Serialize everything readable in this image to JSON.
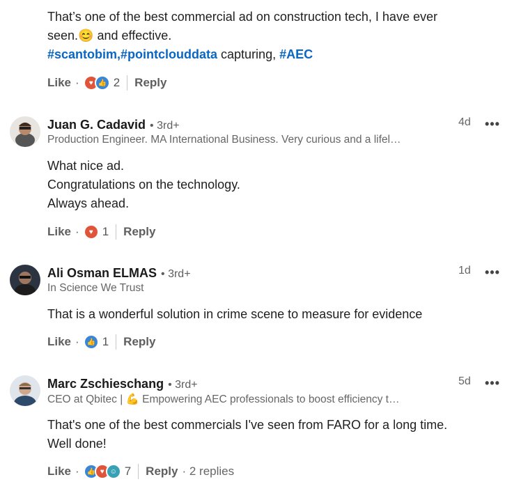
{
  "comment0": {
    "lines": [
      "That’s one of the best commercial ad on construction tech, I have ever",
      "seen."
    ],
    "line2_suffix": " and effective.",
    "emoji": "😊",
    "hashtag1": "#scantobim",
    "hashtag2": ",#pointclouddata",
    "mid_text": " capturing, ",
    "hashtag3": "#AEC",
    "like_label": "Like",
    "reaction_count": "2",
    "reply_label": "Reply"
  },
  "comment1": {
    "name": "Juan G. Cadavid",
    "degree": "• 3rd+",
    "headline": "Production Engineer. MA International Business. Very curious and a lifel…",
    "time": "4d",
    "more": "•••",
    "lines": [
      "What nice ad.",
      "Congratulations on the technology.",
      "Always ahead."
    ],
    "like_label": "Like",
    "reaction_count": "1",
    "reply_label": "Reply"
  },
  "comment2": {
    "name": "Ali Osman ELMAS",
    "degree": "• 3rd+",
    "headline": "In Science We Trust",
    "time": "1d",
    "more": "•••",
    "lines": [
      "That is a wonderful solution in crime scene to measure for evidence"
    ],
    "like_label": "Like",
    "reaction_count": "1",
    "reply_label": "Reply"
  },
  "comment3": {
    "name": "Marc Zschieschang",
    "degree": "• 3rd+",
    "headline": "CEO at Qbitec | 💪 Empowering AEC professionals to boost efficiency t…",
    "time": "5d",
    "more": "•••",
    "lines": [
      "That's one of the best commercials I've seen from FARO for a long time.",
      "Well done!"
    ],
    "like_label": "Like",
    "reaction_count": "7",
    "reply_label": "Reply",
    "replies_label": "· 2 replies"
  },
  "colors": {
    "accent": "#0a66c2",
    "love": "#e0553a",
    "like": "#3a85d6",
    "funny": "#38a1b5"
  },
  "icons": [
    "love-icon",
    "like-icon",
    "funny-icon",
    "more-icon",
    "avatar"
  ]
}
